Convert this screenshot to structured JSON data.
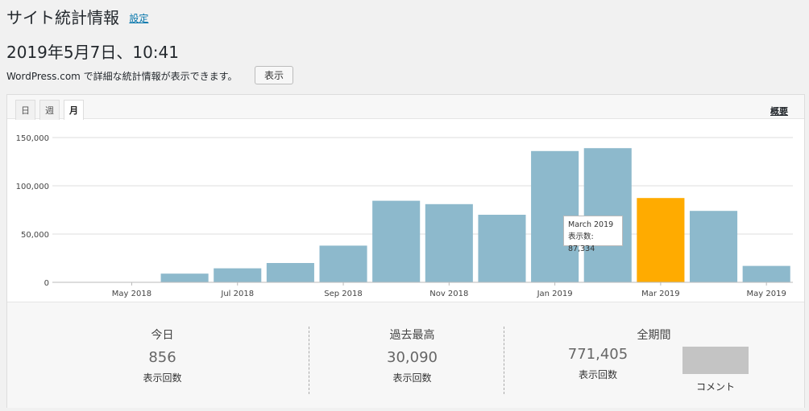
{
  "header": {
    "title": "サイト統計情報",
    "settings_link": "設定",
    "datetime": "2019年5月7日、10:41",
    "notice": "WordPress.com で詳細な統計情報が表示できます。",
    "show_button": "表示"
  },
  "tabs": [
    {
      "label": "日",
      "active": false
    },
    {
      "label": "週",
      "active": false
    },
    {
      "label": "月",
      "active": true
    }
  ],
  "summary_link": "概要",
  "colors": {
    "bar": "#8db9cc",
    "bar_highlight": "#ffab00",
    "grid": "#dddddd"
  },
  "chart_data": {
    "type": "bar",
    "categories": [
      "Apr 2018",
      "May 2018",
      "Jun 2018",
      "Jul 2018",
      "Aug 2018",
      "Sep 2018",
      "Oct 2018",
      "Nov 2018",
      "Dec 2018",
      "Jan 2019",
      "Feb 2019",
      "Mar 2019",
      "Apr 2019",
      "May 2019"
    ],
    "tick_labels": [
      "May 2018",
      "Jul 2018",
      "Sep 2018",
      "Nov 2018",
      "Jan 2019",
      "Mar 2019",
      "May 2019"
    ],
    "tick_indices": [
      1,
      3,
      5,
      7,
      9,
      11,
      13
    ],
    "values": [
      0,
      0,
      9000,
      14500,
      20000,
      38000,
      84500,
      81000,
      70000,
      136000,
      139000,
      87334,
      74000,
      17000
    ],
    "highlight_index": 11,
    "y_ticks": [
      "150,000",
      "100,000",
      "50,000",
      "0"
    ],
    "y_tick_values": [
      150000,
      100000,
      50000,
      0
    ],
    "ylim": [
      0,
      150000
    ],
    "grid": true
  },
  "tooltip": {
    "title": "March 2019",
    "text": "表示数: 87,334"
  },
  "stats": {
    "today": {
      "label": "今日",
      "value": "856",
      "sub": "表示回数"
    },
    "best": {
      "label": "過去最高",
      "value": "30,090",
      "sub": "表示回数"
    },
    "all": {
      "label": "全期間",
      "value": "771,405",
      "sub": "表示回数",
      "comment_label": "コメント"
    }
  }
}
